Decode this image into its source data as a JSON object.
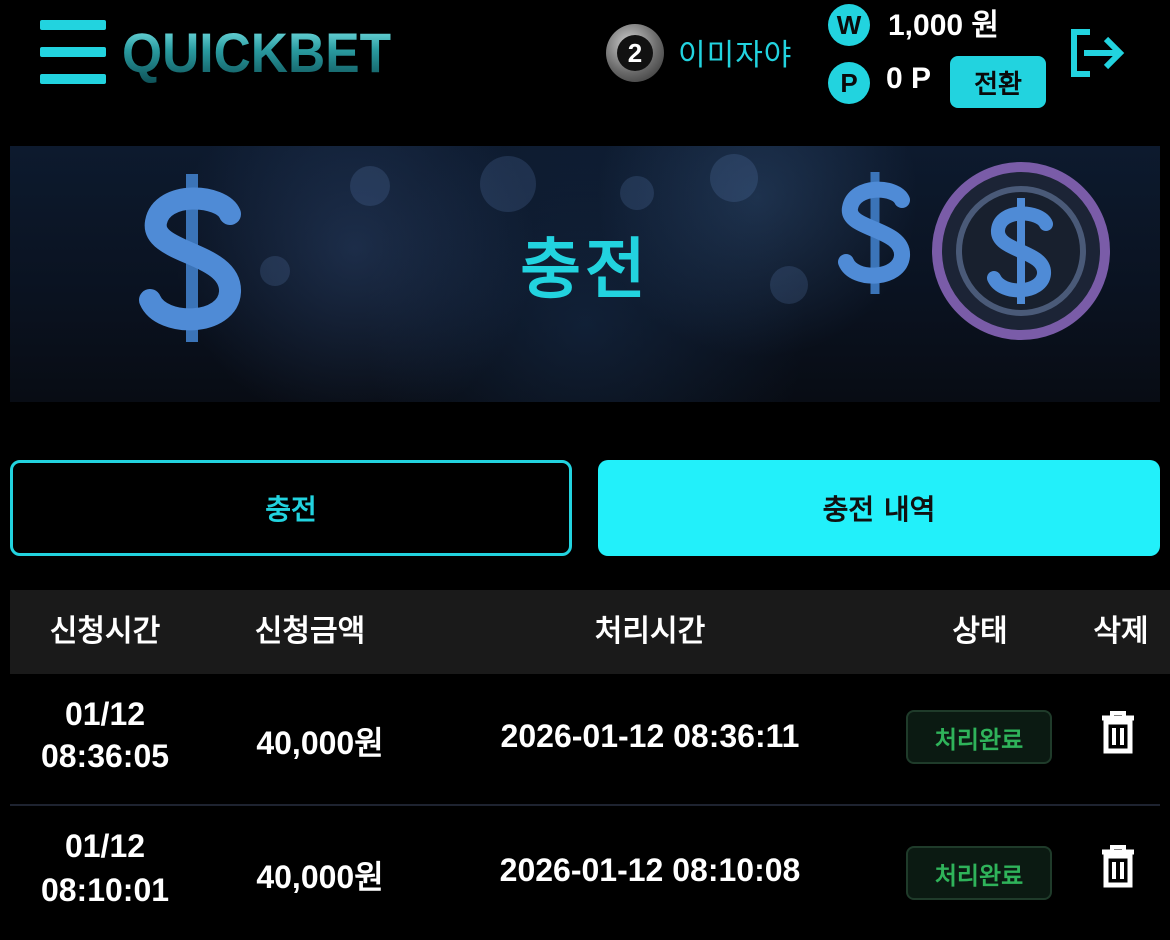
{
  "header": {
    "logo_text": "QUICKBET",
    "level": "2",
    "username": "이미자야",
    "balance": "1,000 원",
    "points": "0 P",
    "convert_label": "전환",
    "coin_w": "W",
    "coin_p": "P",
    "accent_color": "#22d3df"
  },
  "banner": {
    "title": "충전"
  },
  "tabs": [
    {
      "label": "충전",
      "active": false
    },
    {
      "label": "충전 내역",
      "active": true
    }
  ],
  "table": {
    "columns": [
      "신청시간",
      "신청금액",
      "처리시간",
      "상태",
      "삭제"
    ],
    "rows": [
      {
        "date": "01/12",
        "time": "08:36:05",
        "amount": "40,000원",
        "processed": "2026-01-12 08:36:11",
        "status": "처리완료"
      },
      {
        "date": "01/12",
        "time": "08:10:01",
        "amount": "40,000원",
        "processed": "2026-01-12 08:10:08",
        "status": "처리완료"
      }
    ]
  }
}
